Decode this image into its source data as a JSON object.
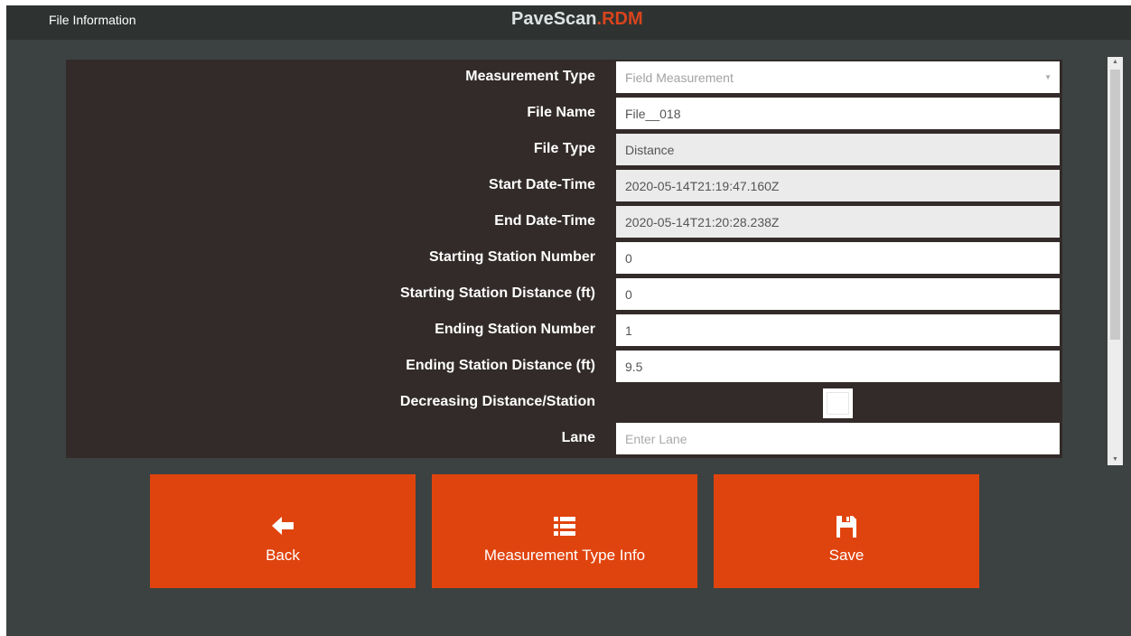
{
  "window": {
    "title": "File Information"
  },
  "brand": {
    "name_main": "PaveScan",
    "name_accent": ".RDM",
    "accent_color": "#d9441c"
  },
  "form": {
    "fields": [
      {
        "label": "Measurement Type",
        "value": "Field Measurement",
        "kind": "select"
      },
      {
        "label": "File Name",
        "value": "File__018",
        "kind": "text"
      },
      {
        "label": "File Type",
        "value": "Distance",
        "kind": "readonly"
      },
      {
        "label": "Start Date-Time",
        "value": "2020-05-14T21:19:47.160Z",
        "kind": "readonly"
      },
      {
        "label": "End Date-Time",
        "value": "2020-05-14T21:20:28.238Z",
        "kind": "readonly"
      },
      {
        "label": "Starting Station Number",
        "value": "0",
        "kind": "text"
      },
      {
        "label": "Starting Station Distance (ft)",
        "value": "0",
        "kind": "text"
      },
      {
        "label": "Ending Station Number",
        "value": "1",
        "kind": "text"
      },
      {
        "label": "Ending Station Distance (ft)",
        "value": "9.5",
        "kind": "text"
      },
      {
        "label": "Decreasing Distance/Station",
        "value": "unchecked",
        "kind": "checkbox"
      },
      {
        "label": "Lane",
        "value": "",
        "placeholder": "Enter Lane",
        "kind": "text"
      }
    ]
  },
  "actions": {
    "back_label": "Back",
    "back_icon": "arrow-left-icon",
    "info_label": "Measurement Type Info",
    "info_icon": "list-icon",
    "save_label": "Save",
    "save_icon": "floppy-disk-icon",
    "button_color": "#e0440e"
  }
}
